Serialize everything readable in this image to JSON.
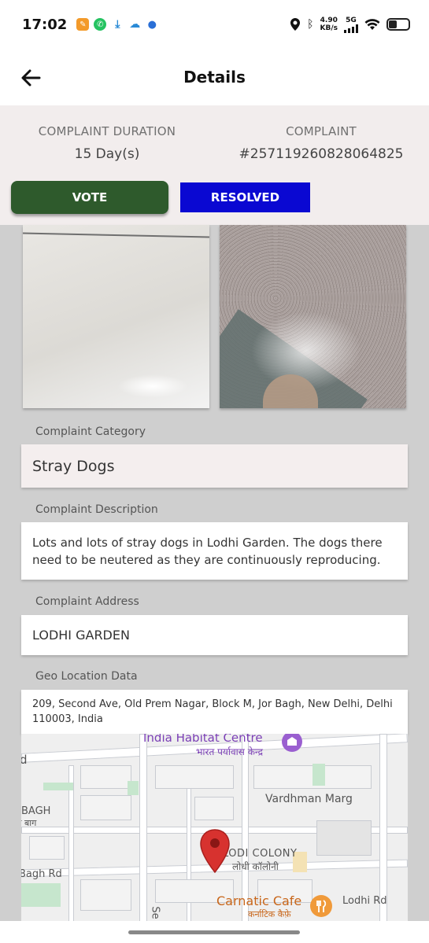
{
  "status_bar": {
    "time": "17:02",
    "speed_value": "4.90",
    "speed_unit": "KB/s",
    "network": "5G"
  },
  "header": {
    "title": "Details"
  },
  "summary": {
    "duration_label": "COMPLAINT DURATION",
    "duration_value": "15 Day(s)",
    "complaint_label": "COMPLAINT",
    "complaint_value": "#257119260828064825"
  },
  "actions": {
    "vote_label": "VOTE",
    "resolved_label": "RESOLVED"
  },
  "fields": {
    "category_label": "Complaint Category",
    "category_value": "Stray Dogs",
    "description_label": "Complaint Description",
    "description_value": "Lots and lots of stray dogs in Lodhi Garden. The dogs there need to be neutered as they are continuously reproducing.",
    "address_label": "Complaint Address",
    "address_value": "LODHI GARDEN",
    "geo_label": "Geo Location Data",
    "geo_value": "209, Second Ave, Old Prem Nagar, Block M, Jor Bagh, New Delhi, Delhi 110003, India"
  },
  "map": {
    "india_habitat": "India Habitat Centre",
    "india_habitat_hi": "भारत पर्यावास केन्द्र",
    "vardhman": "Vardhman Marg",
    "lodi_colony": "LODI COLONY",
    "lodi_colony_hi": "लोधी कॉलोनी",
    "bagh": "BAGH",
    "bagh_hi": "र बाग",
    "bagh_rd": "Bagh Rd",
    "carnatic": "Carnatic Cafe",
    "carnatic_hi": "कर्नाटिक कैफ़े",
    "lodhi_rd": "Lodhi Rd",
    "d": "d",
    "se": "Se"
  },
  "colors": {
    "vote": "#2e5a2c",
    "resolved": "#0a08d2",
    "summary_bg": "#f2eded",
    "page_bg": "#cfcfcf"
  }
}
